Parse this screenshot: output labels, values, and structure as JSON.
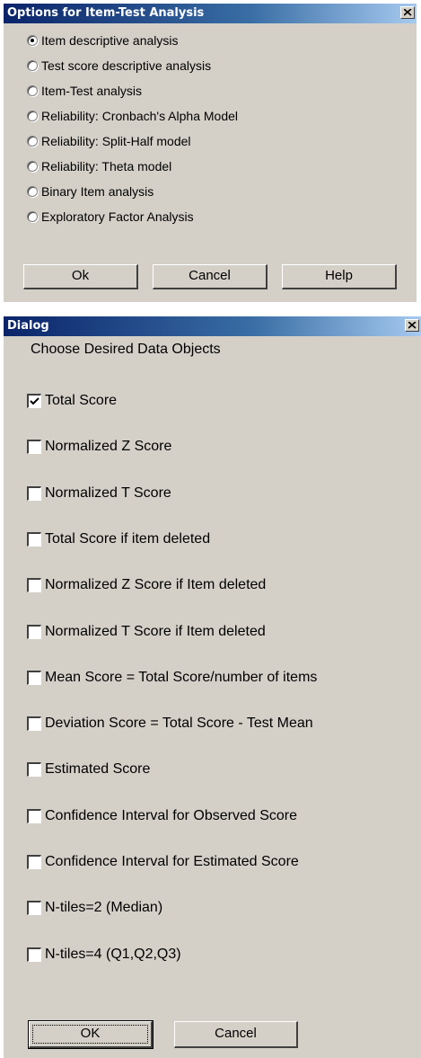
{
  "dialog1": {
    "title": "Options for Item-Test Analysis",
    "options": [
      {
        "label": "Item descriptive analysis",
        "checked": true
      },
      {
        "label": "Test score descriptive analysis",
        "checked": false
      },
      {
        "label": "Item-Test analysis",
        "checked": false
      },
      {
        "label": "Reliability: Cronbach's Alpha Model",
        "checked": false
      },
      {
        "label": "Reliability: Split-Half model",
        "checked": false
      },
      {
        "label": "Reliability: Theta model",
        "checked": false
      },
      {
        "label": "Binary Item analysis",
        "checked": false
      },
      {
        "label": "Exploratory Factor Analysis",
        "checked": false
      }
    ],
    "buttons": {
      "ok": "Ok",
      "cancel": "Cancel",
      "help": "Help"
    }
  },
  "dialog2": {
    "title": "Dialog",
    "prompt": "Choose Desired Data Objects",
    "items": [
      {
        "label": "Total Score",
        "checked": true
      },
      {
        "label": "Normalized Z Score",
        "checked": false
      },
      {
        "label": "Normalized T Score",
        "checked": false
      },
      {
        "label": "Total Score if item deleted",
        "checked": false
      },
      {
        "label": "Normalized Z Score if Item deleted",
        "checked": false
      },
      {
        "label": "Normalized T Score if Item deleted",
        "checked": false
      },
      {
        "label": "Mean Score = Total Score/number of items",
        "checked": false
      },
      {
        "label": "Deviation Score = Total Score - Test Mean",
        "checked": false
      },
      {
        "label": "Estimated Score",
        "checked": false
      },
      {
        "label": "Confidence Interval for Observed Score",
        "checked": false
      },
      {
        "label": "Confidence Interval for Estimated Score",
        "checked": false
      },
      {
        "label": "N-tiles=2 (Median)",
        "checked": false
      },
      {
        "label": "N-tiles=4 (Q1,Q2,Q3)",
        "checked": false
      }
    ],
    "buttons": {
      "ok": "OK",
      "cancel": "Cancel"
    }
  },
  "icons": {
    "close": "close-icon",
    "check": "checkmark-icon"
  }
}
